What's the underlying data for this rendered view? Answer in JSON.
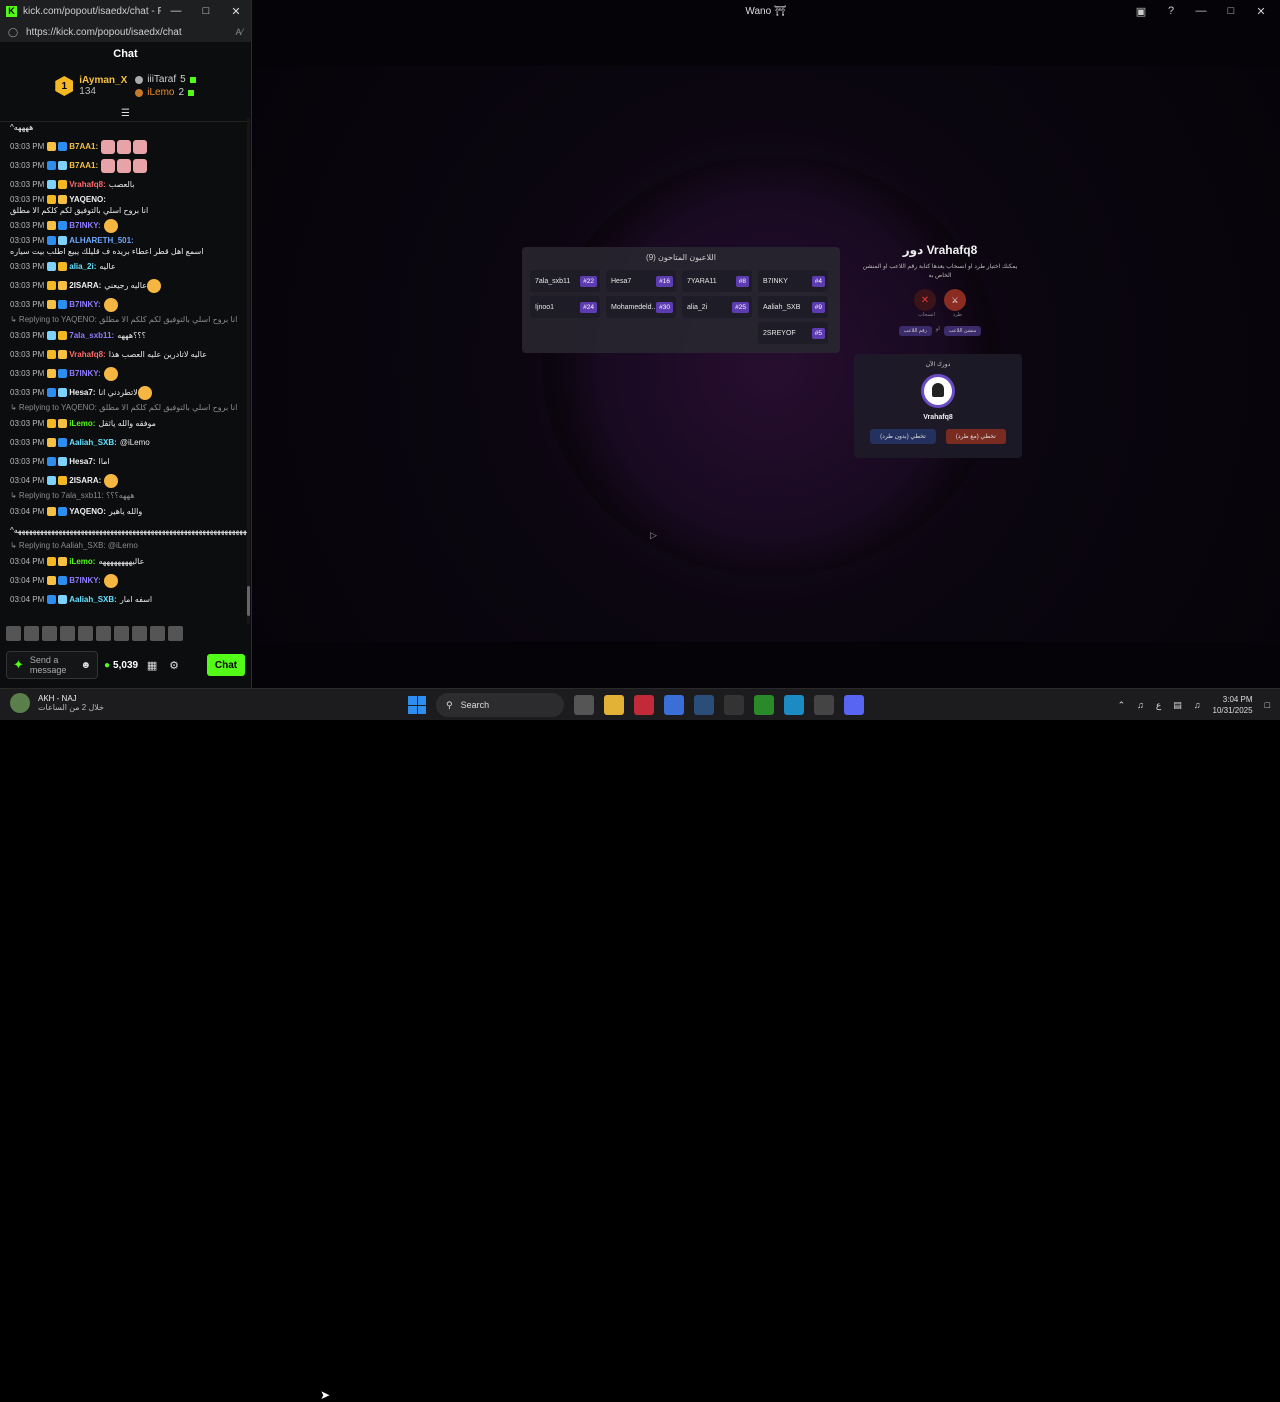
{
  "chat_window": {
    "title": "kick.com/popout/isaedx/chat - Person...",
    "url": "https://kick.com/popout/isaedx/chat",
    "header": "Chat",
    "leaderboard": {
      "first": {
        "rank": "1",
        "name": "iAyman_X",
        "points": "134"
      },
      "second": {
        "name": "iiiTaraf",
        "points": "5"
      },
      "third": {
        "name": "iLemo",
        "points": "2"
      }
    },
    "messages": [
      {
        "type": "text",
        "time": "",
        "user": "",
        "text": "^ههههه",
        "color": "#e9e9e9"
      },
      {
        "type": "msg",
        "time": "03:03 PM",
        "user": "B7AA1:",
        "text": "",
        "color": "#f6c142",
        "emotes": 3
      },
      {
        "type": "msg",
        "time": "03:03 PM",
        "user": "B7AA1:",
        "text": "",
        "color": "#f6c142",
        "emotes": 3
      },
      {
        "type": "msg",
        "time": "03:03 PM",
        "user": "Vrahafq8:",
        "text": "بالعصب",
        "color": "#ff6a6a"
      },
      {
        "type": "msg",
        "time": "03:03 PM",
        "user": "YAQENO:",
        "text": "انا بروح اسلي بالتوفيق لكم كلكم الا مطلق",
        "color": "#f0f0f0"
      },
      {
        "type": "msg",
        "time": "03:03 PM",
        "user": "B7INKY:",
        "text": "",
        "color": "#8f7dff",
        "emotes": 1
      },
      {
        "type": "msg",
        "time": "03:03 PM",
        "user": "ALHARETH_501:",
        "text": "اسمع اهل قطر اعطاء بريده ف قليلك يبيع اطلب بيت سياره",
        "color": "#6fa8ff"
      },
      {
        "type": "msg",
        "time": "03:03 PM",
        "user": "alia_2i:",
        "text": "عاليه",
        "color": "#66e0ff"
      },
      {
        "type": "msg",
        "time": "03:03 PM",
        "user": "2ISARA:",
        "text": "عاليه رجيعني",
        "color": "#f0f0f0",
        "emotes": 1
      },
      {
        "type": "msg",
        "time": "03:03 PM",
        "user": "B7INKY:",
        "text": "",
        "color": "#8f7dff",
        "emotes": 1
      },
      {
        "type": "reply",
        "text": "↳ Replying to YAQENO: انا بروح اسلي بالتوفيق لكم كلكم الا مطلق"
      },
      {
        "type": "msg",
        "time": "03:03 PM",
        "user": "7ala_sxb11:",
        "text": "؟؟؟هههه",
        "color": "#8f7dff"
      },
      {
        "type": "msg",
        "time": "03:03 PM",
        "user": "Vrahafq8:",
        "text": "عاليه لاتادرين عليه العصب هذا",
        "color": "#ff6a6a"
      },
      {
        "type": "msg",
        "time": "03:03 PM",
        "user": "B7INKY:",
        "text": "",
        "color": "#8f7dff",
        "emotes": 1
      },
      {
        "type": "msg",
        "time": "03:03 PM",
        "user": "Hesa7:",
        "text": "لاتطردني انا",
        "color": "#f0f0f0",
        "emotes": 1
      },
      {
        "type": "reply",
        "text": "↳ Replying to YAQENO: انا بروح اسلي بالتوفيق لكم كلكم الا مطلق"
      },
      {
        "type": "msg",
        "time": "03:03 PM",
        "user": "iLemo:",
        "text": "موفقه والله ياثقل",
        "color": "#53fc18"
      },
      {
        "type": "msg",
        "time": "03:03 PM",
        "user": "Aaliah_SXB:",
        "text": "@iLemo",
        "color": "#66e0ff"
      },
      {
        "type": "msg",
        "time": "03:03 PM",
        "user": "Hesa7:",
        "text": "اماا",
        "color": "#f0f0f0"
      },
      {
        "type": "msg",
        "time": "03:04 PM",
        "user": "2ISARA:",
        "text": "",
        "color": "#f0f0f0",
        "emotes": 1
      },
      {
        "type": "reply",
        "text": "↳ Replying to 7ala_sxb11: هههه؟؟؟"
      },
      {
        "type": "msg",
        "time": "03:04 PM",
        "user": "YAQENO:",
        "text": "والله ياهير",
        "color": "#f0f0f0"
      },
      {
        "type": "text",
        "time": "",
        "user": "",
        "text": "^ههههههههههههههههههههههههههههههههههههههههههههههههههههههههههههههههههههههه^",
        "color": "#e9e9e9"
      },
      {
        "type": "reply",
        "text": "↳ Replying to Aaliah_SXB: @iLemo"
      },
      {
        "type": "msg",
        "time": "03:04 PM",
        "user": "iLemo:",
        "text": "عاليههههههههه",
        "color": "#53fc18"
      },
      {
        "type": "msg",
        "time": "03:04 PM",
        "user": "B7INKY:",
        "text": "",
        "color": "#8f7dff",
        "emotes": 1
      },
      {
        "type": "msg",
        "time": "03:04 PM",
        "user": "Aaliah_SXB:",
        "text": "اسفه امار",
        "color": "#66e0ff"
      }
    ],
    "input_placeholder": "Send a message",
    "points": "5,039",
    "chat_button": "Chat"
  },
  "game_window": {
    "title": "Wano ⛩",
    "players_panel": {
      "title": "اللاعبون المتاحون (9)",
      "players": [
        {
          "name": "7ala_sxb11",
          "num": "#22"
        },
        {
          "name": "Hesa7",
          "num": "#16"
        },
        {
          "name": "7YARA11",
          "num": "#8"
        },
        {
          "name": "B7INKY",
          "num": "#4"
        },
        {
          "name": "Ijnoo1",
          "num": "#24"
        },
        {
          "name": "Mohamedeld..",
          "num": "#30"
        },
        {
          "name": "alia_2i",
          "num": "#25"
        },
        {
          "name": "Aaliah_SXB",
          "num": "#9"
        },
        {
          "name": "",
          "num": ""
        },
        {
          "name": "",
          "num": ""
        },
        {
          "name": "",
          "num": ""
        },
        {
          "name": "2SREYOF",
          "num": "#5"
        }
      ]
    },
    "turn_panel": {
      "title": "دور Vrahafq8",
      "subtitle": "يمكنك اختيار طرد او انسحاب بعدها كتابة رقم اللاعب او المنشن الخاص به",
      "option_withdraw": "انسحاب",
      "option_kick": "طرد",
      "chip_number": "رقم اللاعب",
      "chip_or": "او",
      "chip_mention": "منشن اللاعب"
    },
    "now_panel": {
      "label": "دورك الآن",
      "name": "Vrahafq8",
      "skip_without": "تخطي (بدون طرد)",
      "skip_with": "تخطي (مع طرد)"
    }
  },
  "taskbar": {
    "weather_title": "AKH - NAJ",
    "weather_sub": "خلال 2 من الساعات",
    "search": "Search",
    "time": "3:04 PM",
    "date": "10/31/2025",
    "lang": "ع"
  }
}
